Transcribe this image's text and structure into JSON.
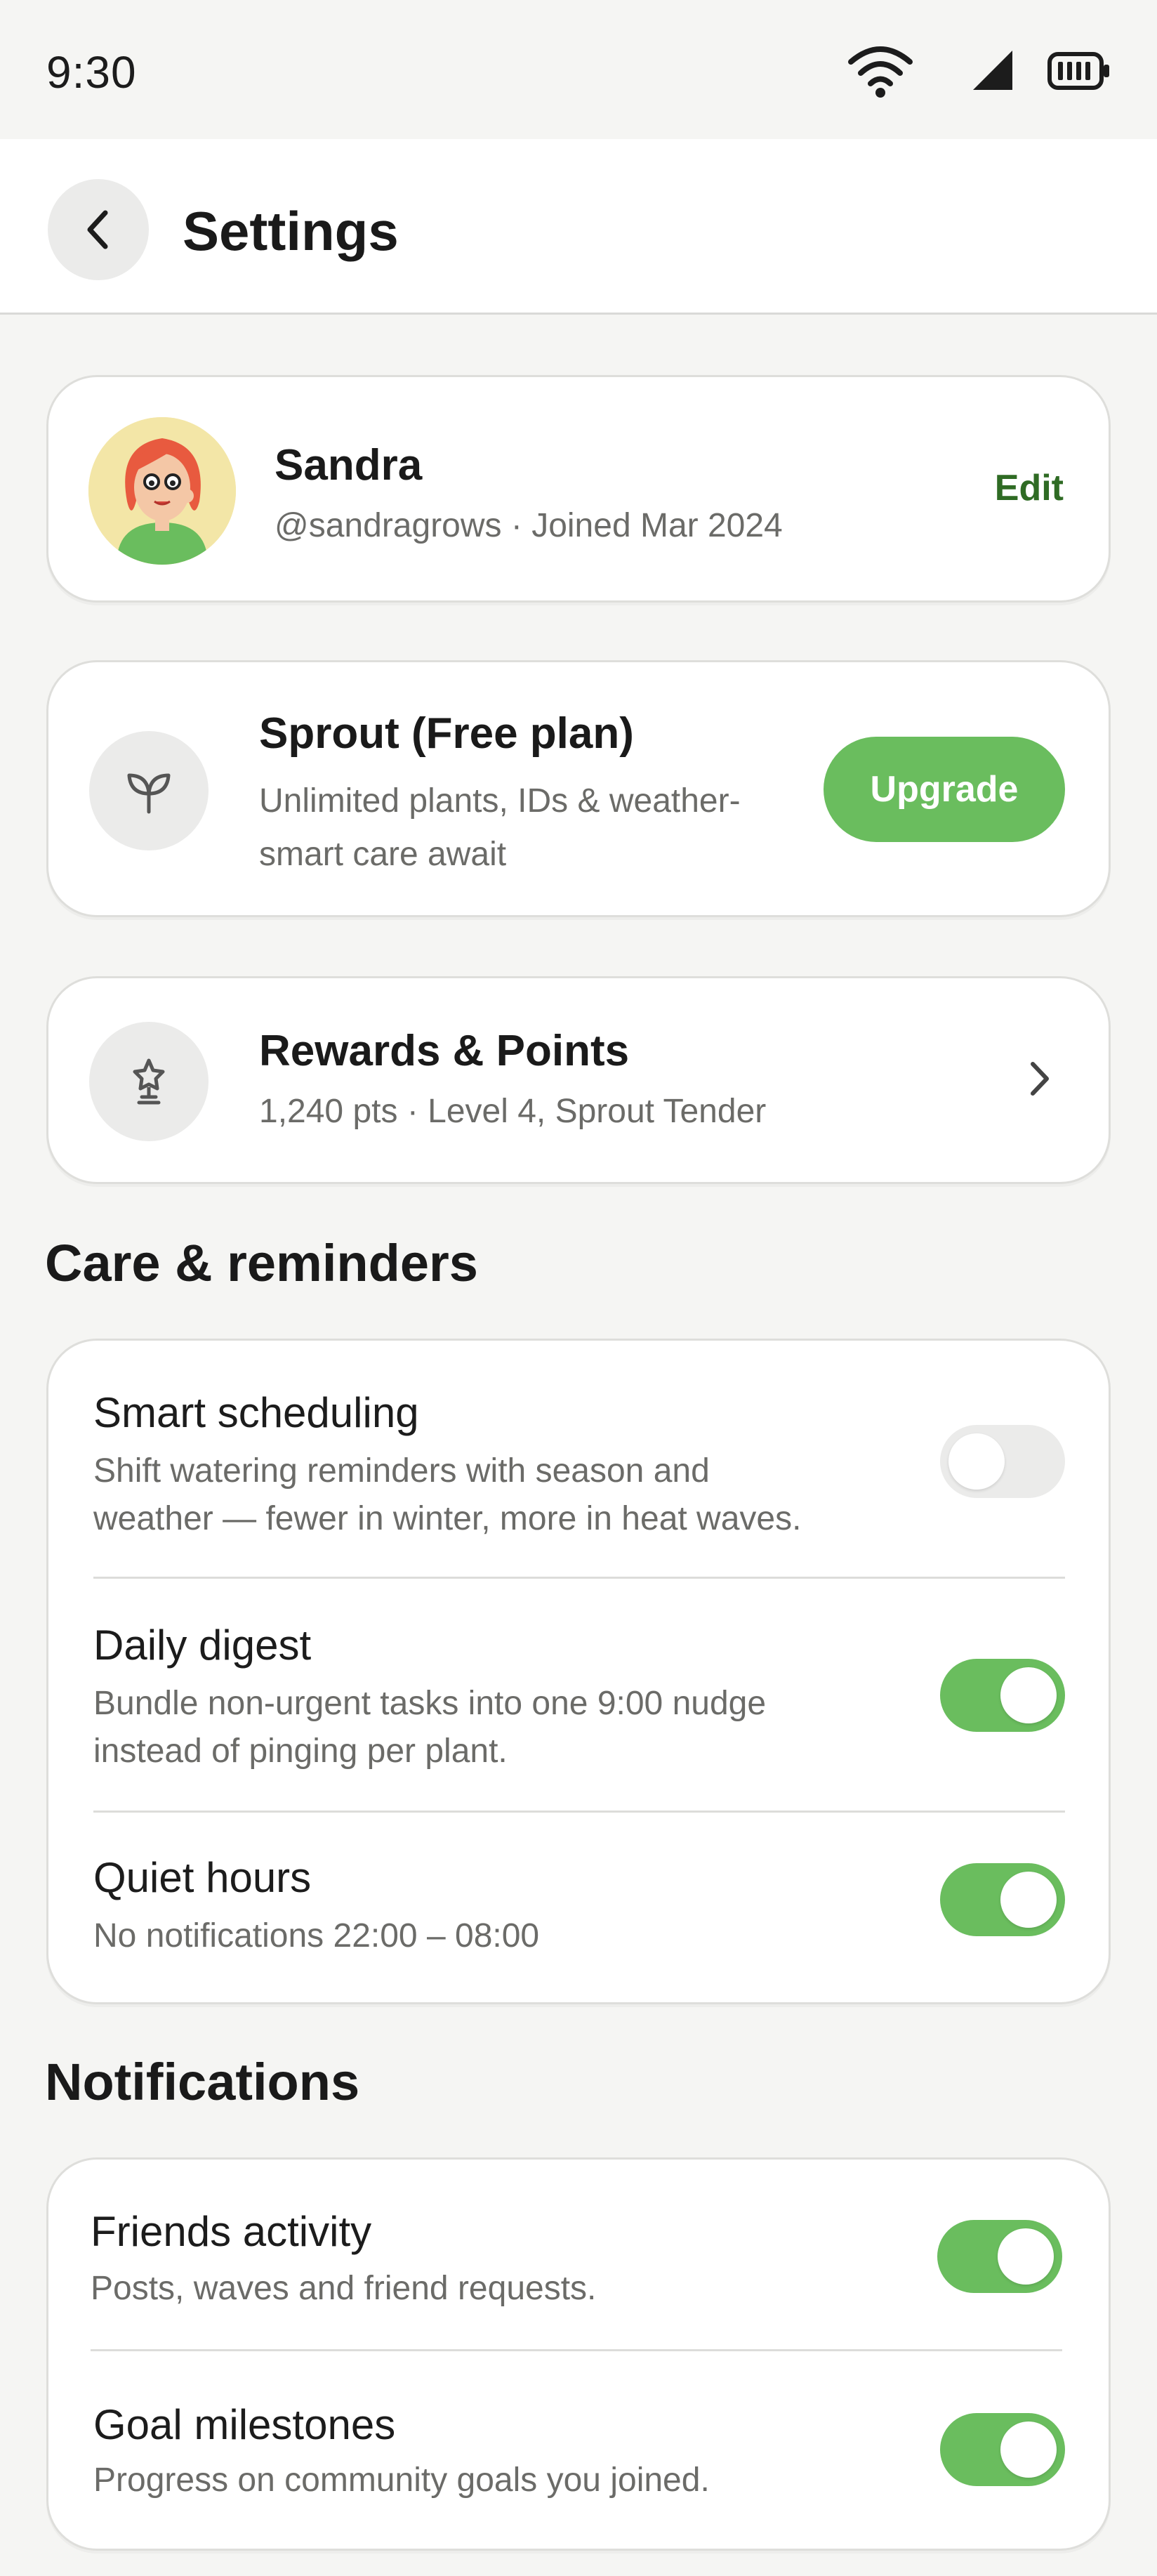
{
  "status_bar": {
    "time": "9:30",
    "icons": [
      "wifi-icon",
      "cellular-signal-icon",
      "battery-icon"
    ]
  },
  "header": {
    "back_icon": "chevron-left-icon",
    "title": "Settings"
  },
  "profile": {
    "name": "Sandra",
    "meta": "@sandragrows · Joined Mar 2024",
    "edit_label": "Edit"
  },
  "plan": {
    "icon": "sprout-icon",
    "title": "Sprout (Free plan)",
    "description": "Unlimited plants, IDs & weather-smart care await",
    "upgrade_label": "Upgrade"
  },
  "rewards": {
    "icon": "trophy-icon",
    "title": "Rewards & Points",
    "meta": "1,240 pts · Level 4, Sprout Tender"
  },
  "care": {
    "heading": "Care & reminders",
    "items": [
      {
        "title": "Smart scheduling",
        "description": "Shift watering reminders with season and weather — fewer in winter, more in heat waves.",
        "enabled": false
      },
      {
        "title": "Daily digest",
        "description": "Bundle non-urgent tasks into one 9:00 nudge instead of pinging per plant.",
        "enabled": true
      },
      {
        "title": "Quiet hours",
        "description": "No notifications 22:00 – 08:00",
        "enabled": true
      }
    ]
  },
  "notifications": {
    "heading": "Notifications",
    "items": [
      {
        "title": "Friends activity",
        "description": "Posts, waves and friend requests.",
        "enabled": true
      },
      {
        "title": "Goal milestones",
        "description": "Progress on community goals you joined.",
        "enabled": true
      }
    ]
  },
  "colors": {
    "accent_green": "#6abd5e",
    "edit_green": "#2f6b24",
    "background": "#f5f5f3",
    "card": "#ffffff"
  }
}
